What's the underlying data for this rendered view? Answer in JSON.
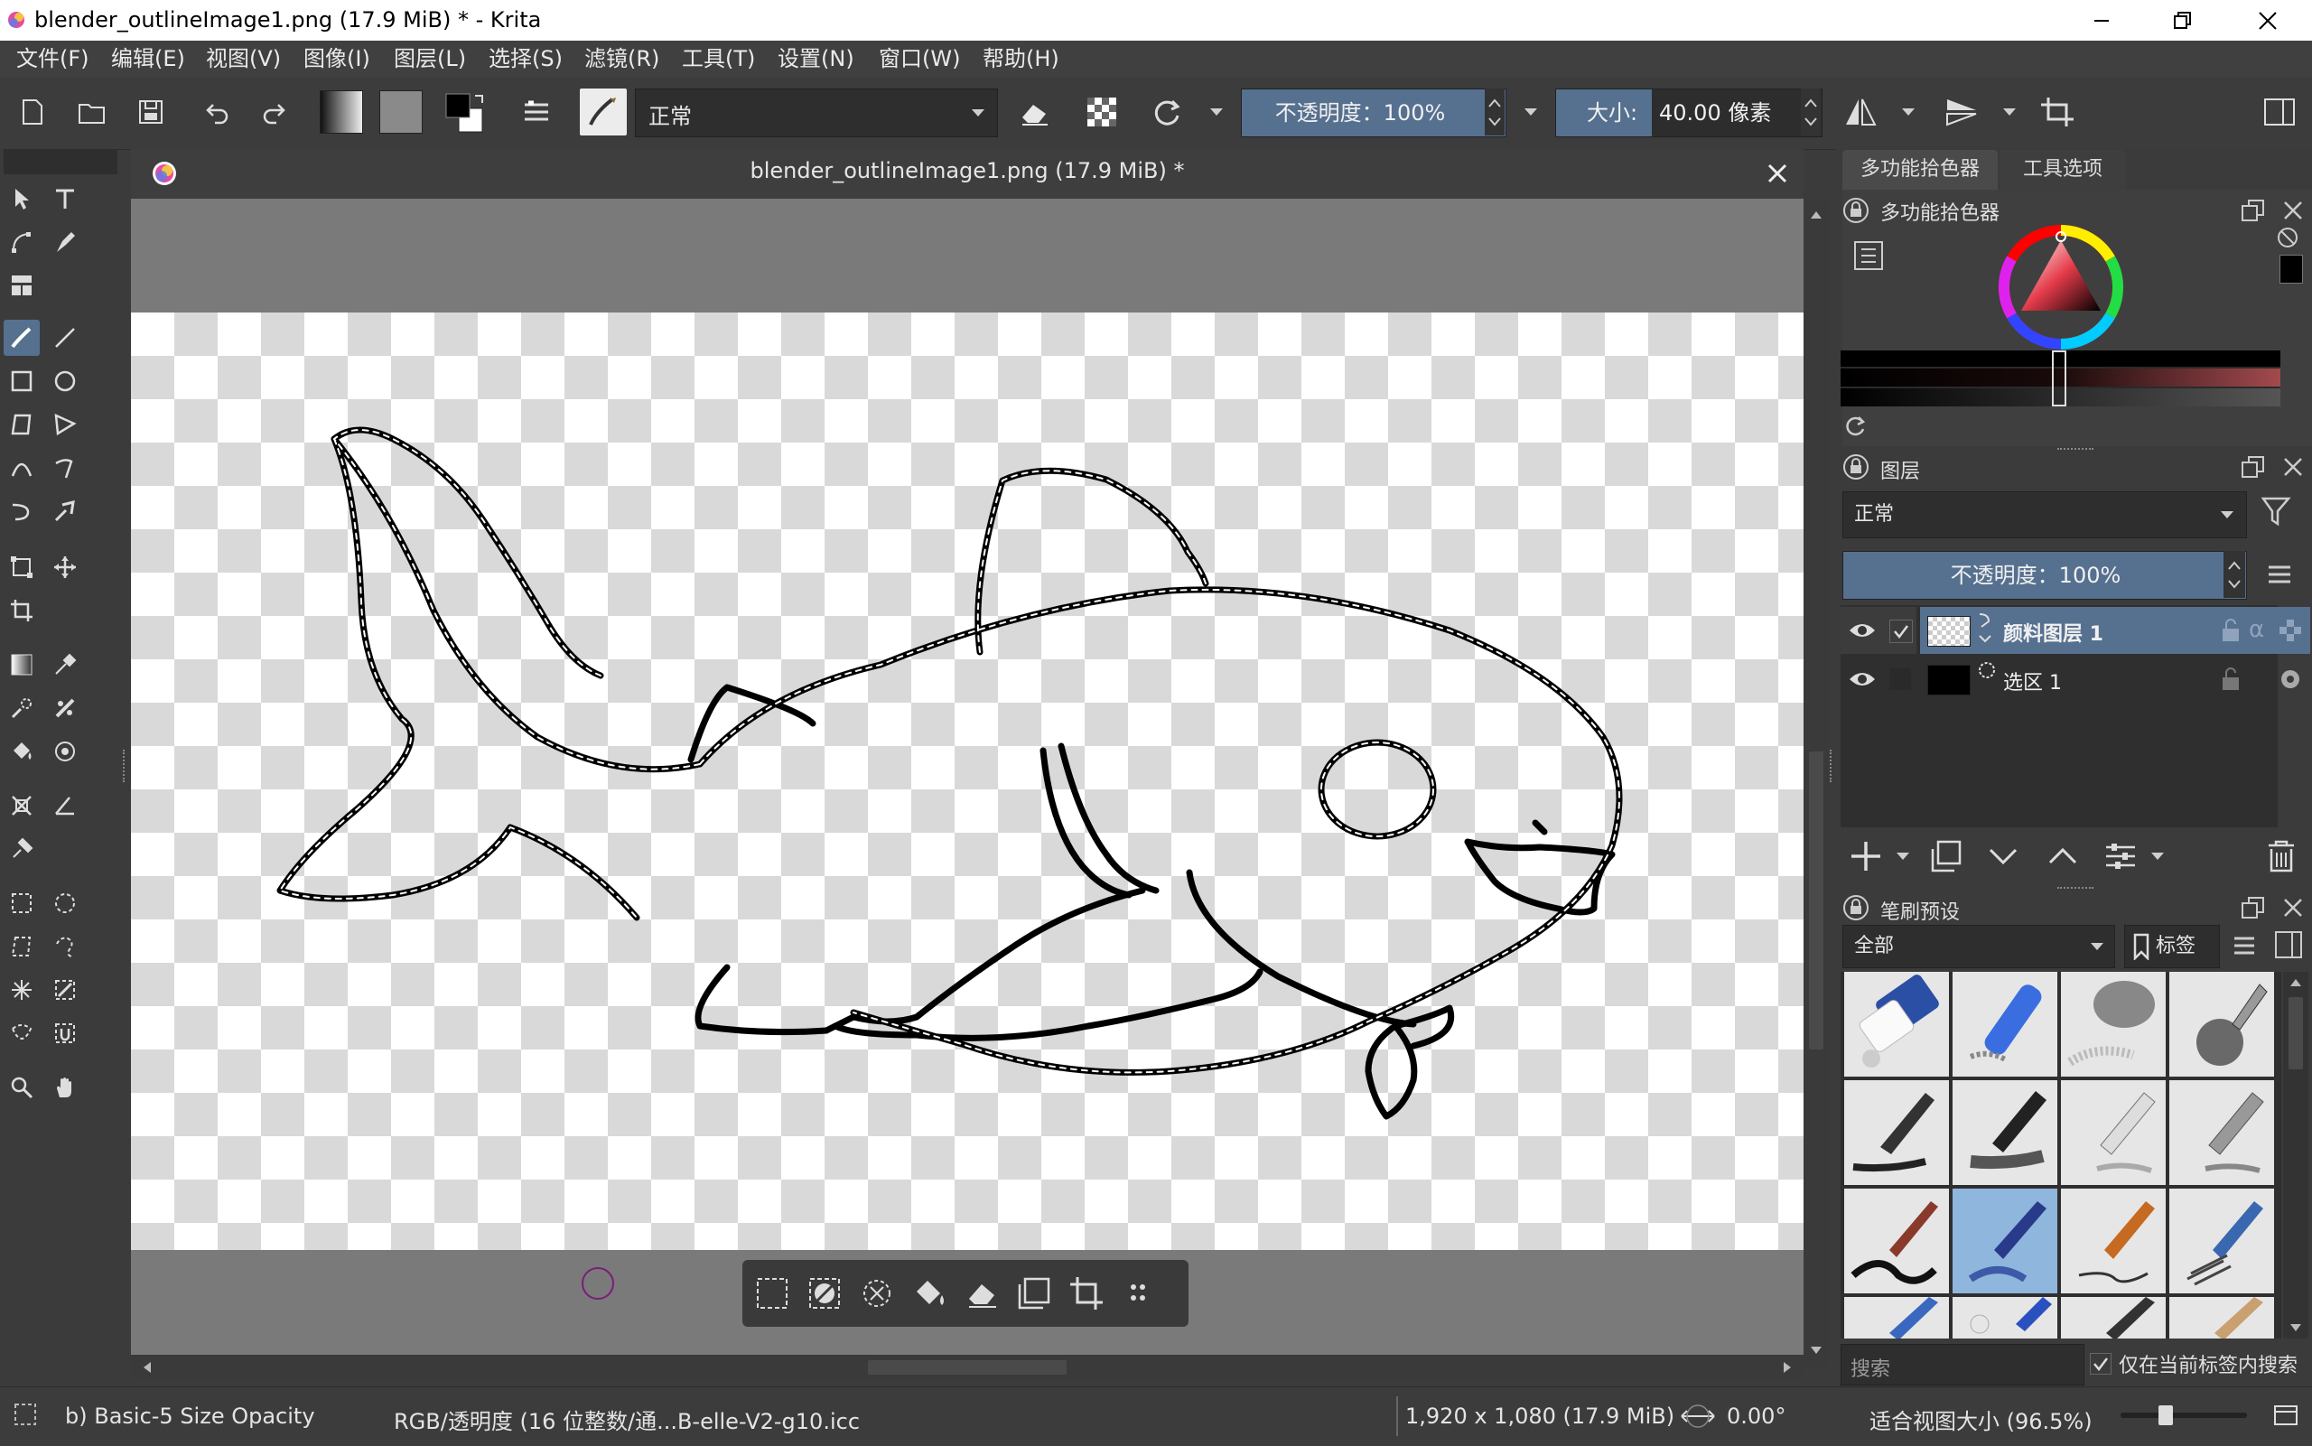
{
  "window": {
    "title": "blender_outlineImage1.png (17.9 MiB) * - Krita",
    "controls": [
      "minimize",
      "restore",
      "close"
    ]
  },
  "menu": [
    "文件(F)",
    "编辑(E)",
    "视图(V)",
    "图像(I)",
    "图层(L)",
    "选择(S)",
    "滤镜(R)",
    "工具(T)",
    "设置(N)",
    "窗口(W)",
    "帮助(H)"
  ],
  "toolbar": {
    "blend_mode": "正常",
    "opacity_label": "不透明度：100%",
    "opacity_value": 100,
    "size_label": "大小:",
    "size_value": "40.00 像素"
  },
  "document": {
    "tab_title": "blender_outlineImage1.png (17.9 MiB) *"
  },
  "dockers": {
    "tabs": [
      "多功能拾色器",
      "工具选项"
    ],
    "color_panel_title": "多功能拾色器",
    "layers_title": "图层",
    "layer_blend_mode": "正常",
    "layer_opacity_label": "不透明度：100%",
    "layers": [
      {
        "name": "颜料图层 1",
        "selected": true
      },
      {
        "name": "选区 1",
        "selected": false
      }
    ],
    "brush_presets_title": "笔刷预设",
    "brush_filter": "全部",
    "brush_tag_label": "标签",
    "search_placeholder": "搜索",
    "only_current_tag_label": "仅在当前标签内搜索"
  },
  "status": {
    "brush_name": "b) Basic-5 Size Opacity",
    "color_profile": "RGB/透明度 (16 位整数/通...B-elle-V2-g10.icc",
    "dimensions": "1,920 x 1,080 (17.9 MiB)",
    "rotation": "0.00°",
    "zoom_label": "适合视图大小 (96.5%)"
  },
  "colors": {
    "accent": "#56708f",
    "panel_bg": "#3b3b3b",
    "canvas_gray": "#7a7a7a",
    "checker_dark": "#d9d9d9",
    "foreground_color": "#000000",
    "background_color": "#ffffff"
  }
}
